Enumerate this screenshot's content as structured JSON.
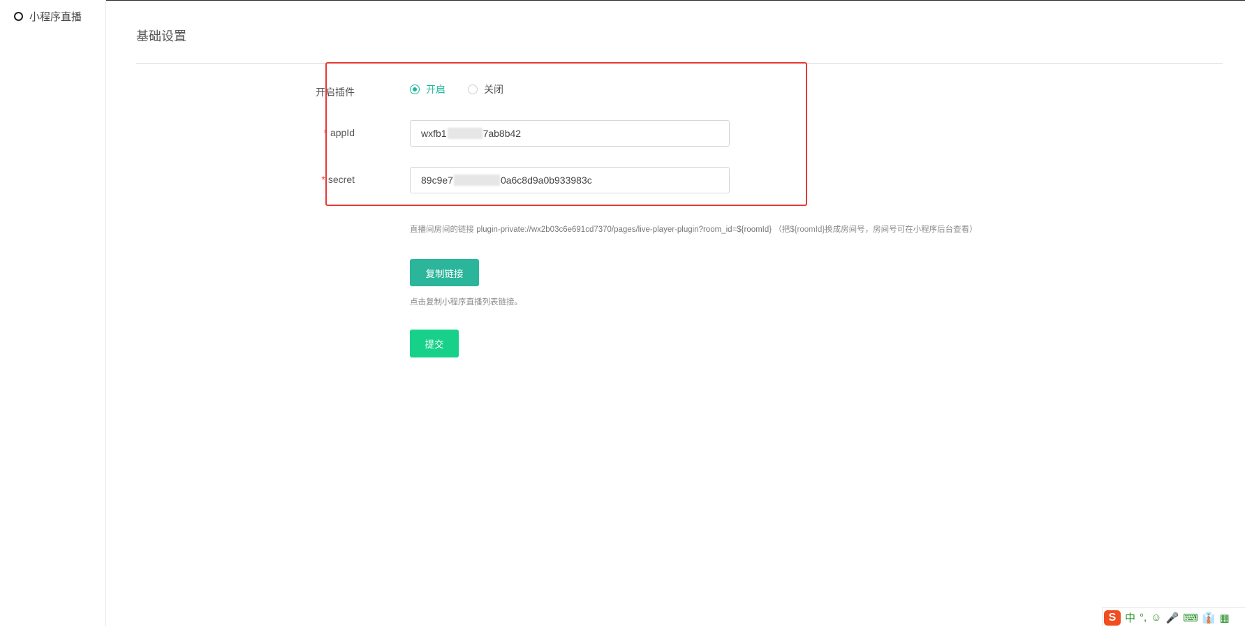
{
  "sidebar": {
    "items": [
      {
        "label": "小程序直播"
      }
    ]
  },
  "main": {
    "section_title": "基础设置",
    "form": {
      "plugin": {
        "label": "开启插件",
        "options": [
          {
            "label": "开启",
            "checked": true
          },
          {
            "label": "关闭",
            "checked": false
          }
        ]
      },
      "appid": {
        "required_mark": "*",
        "label": "appId",
        "value_start": "wxfb1",
        "value_end": "7ab8b42"
      },
      "secret": {
        "required_mark": "*",
        "label": "secret",
        "value_start": "89c9e7",
        "value_end": "0a6c8d9a0b933983c"
      }
    },
    "link_hint": {
      "prefix": "直播间房间的链接",
      "url": "plugin-private://wx2b03c6e691cd7370/pages/live-player-plugin?room_id=${roomId}",
      "suffix": "（把${roomId}换成房间号，房间号可在小程序后台查看）"
    },
    "copy_button": "复制链接",
    "copy_hint": "点击复制小程序直播列表链接。",
    "submit_button": "提交"
  },
  "ime_toolbar": {
    "logo": "S",
    "items": [
      "中",
      "°,",
      "☺",
      "🎤",
      "⌨",
      "👔",
      "▦"
    ]
  },
  "colors": {
    "accent": "#1fb89c",
    "copy_button": "#2bb59a",
    "submit_button": "#17d18a",
    "required": "#e8472e",
    "highlight_box": "#e53935"
  }
}
